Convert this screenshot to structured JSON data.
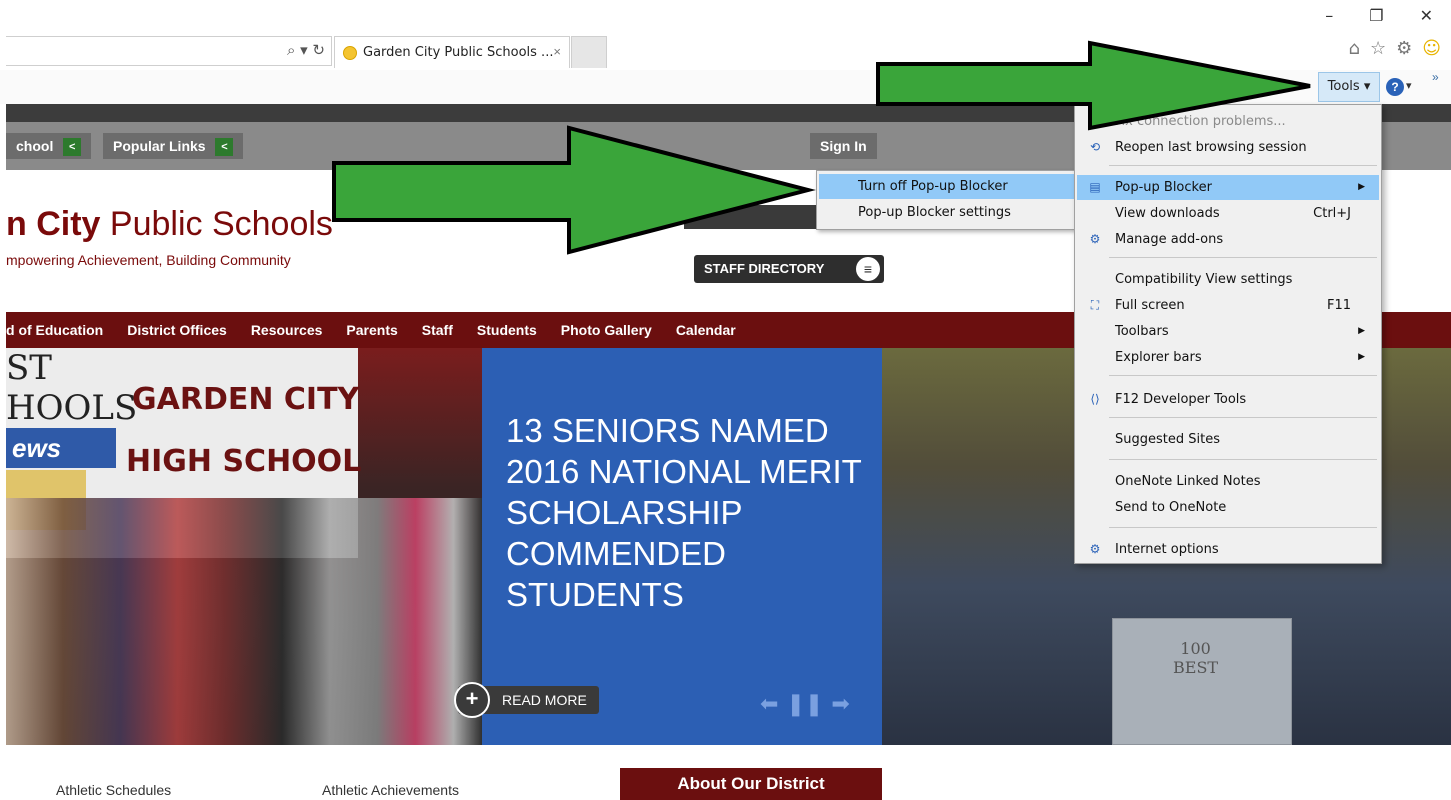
{
  "browser": {
    "tab_title": "Garden City Public Schools ...",
    "tab_close": "×",
    "address_icons": "⌕ ▾ ↻",
    "window_controls": {
      "minimize": "–",
      "restore": "❐",
      "close": "✕"
    },
    "toolbar_icons": {
      "home": "⌂",
      "favorites": "☆",
      "settings": "⚙",
      "feedback": "☺"
    },
    "safety_caret": "▾",
    "tools_label": "Tools ▾",
    "help_label": "?",
    "help_caret": "▾",
    "more_chevron": "»"
  },
  "site": {
    "top_buttons": [
      {
        "label": "chool",
        "chevron": "<"
      },
      {
        "label": "Popular Links",
        "chevron": "<"
      }
    ],
    "sign_in": "Sign In",
    "title_bold": "n City",
    "title_rest": " Public Schools",
    "tagline": "mpowering Achievement, Building Community",
    "staff_directory": "STAFF DIRECTORY",
    "staff_directory_icon": "≡",
    "nav": [
      "d of Education",
      "District Offices",
      "Resources",
      "Parents",
      "Staff",
      "Students",
      "Photo Gallery",
      "Calendar"
    ],
    "hero": {
      "banner_top": "ST\nHOOLS",
      "banner_line1": "GARDEN CITY",
      "banner_line2": "HIGH SCHOOL",
      "banner_badge": "ews",
      "headline": "13 SENIORS NAMED 2016 NATIONAL MERIT SCHOLARSHIP COMMENDED STUDENTS",
      "read_more": "READ MORE",
      "read_more_icon": "+",
      "slider_prev": "⬅",
      "slider_pause": "❚❚",
      "slider_next": "➡",
      "flag_text": "100\nBEST"
    },
    "bottom": {
      "athletic_schedules": "Athletic Schedules",
      "athletic_achievements": "Athletic Achievements",
      "about": "About Our District"
    }
  },
  "popup_submenu": {
    "items": [
      "Turn off Pop-up Blocker",
      "Pop-up Blocker settings"
    ]
  },
  "tools_menu": {
    "items": [
      {
        "label": "Fix connection problems...",
        "shortcut": "",
        "submenu": false,
        "disabled": true,
        "icon": ""
      },
      {
        "label": "Reopen last browsing session",
        "shortcut": "",
        "submenu": false,
        "disabled": false,
        "icon": "⟲"
      },
      {
        "label": "Pop-up Blocker",
        "shortcut": "",
        "submenu": true,
        "disabled": false,
        "icon": "▤"
      },
      {
        "label": "View downloads",
        "shortcut": "Ctrl+J",
        "submenu": false,
        "disabled": false,
        "icon": ""
      },
      {
        "label": "Manage add-ons",
        "shortcut": "",
        "submenu": false,
        "disabled": false,
        "icon": "⚙"
      },
      {
        "label": "Compatibility View settings",
        "shortcut": "",
        "submenu": false,
        "disabled": false,
        "icon": ""
      },
      {
        "label": "Full screen",
        "shortcut": "F11",
        "submenu": false,
        "disabled": false,
        "icon": "⛶"
      },
      {
        "label": "Toolbars",
        "shortcut": "",
        "submenu": true,
        "disabled": false,
        "icon": ""
      },
      {
        "label": "Explorer bars",
        "shortcut": "",
        "submenu": true,
        "disabled": false,
        "icon": ""
      },
      {
        "label": "F12 Developer Tools",
        "shortcut": "",
        "submenu": false,
        "disabled": false,
        "icon": "⟨⟩"
      },
      {
        "label": "Suggested Sites",
        "shortcut": "",
        "submenu": false,
        "disabled": false,
        "icon": ""
      },
      {
        "label": "OneNote Linked Notes",
        "shortcut": "",
        "submenu": false,
        "disabled": false,
        "icon": ""
      },
      {
        "label": "Send to OneNote",
        "shortcut": "",
        "submenu": false,
        "disabled": false,
        "icon": ""
      },
      {
        "label": "Internet options",
        "shortcut": "",
        "submenu": false,
        "disabled": false,
        "icon": "⚙"
      }
    ],
    "submenu_arrow": "▶"
  },
  "colors": {
    "arrow_fill": "#3aa53a",
    "arrow_stroke": "#000000",
    "highlight": "#91c9f7",
    "maroon": "#6b0f0f",
    "hero_blue": "#2c5fb4"
  }
}
